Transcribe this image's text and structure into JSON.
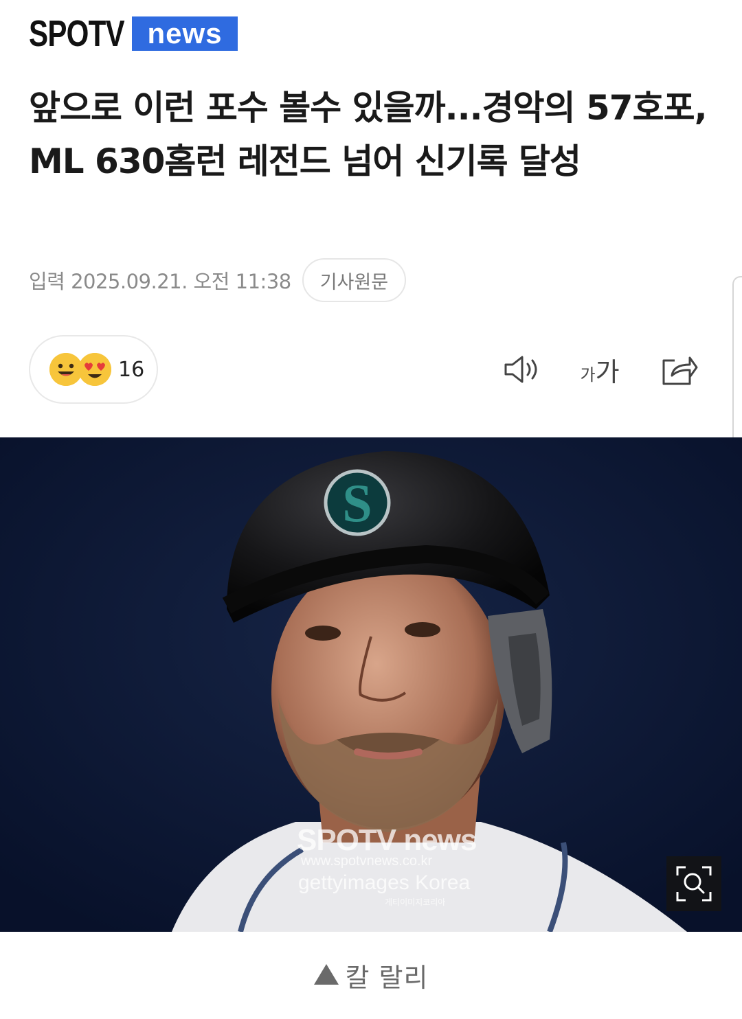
{
  "logo": {
    "part1": "SPOTV",
    "part2": "news"
  },
  "headline": "앞으로 이런 포수 볼수 있을까...경악의 57호포, ML 630홈런 레전드 넘어 신기록 달성",
  "meta": {
    "date": "입력 2025.09.21. 오전 11:38",
    "original_button": "기사원문"
  },
  "reaction": {
    "count": "16",
    "icons": [
      "smile-emoji",
      "heart-eyes-emoji"
    ]
  },
  "tools": {
    "font_small": "가",
    "font_large": "가",
    "icons": [
      "speaker-icon",
      "font-size-icon",
      "share-icon"
    ]
  },
  "photo": {
    "watermark_logo": "SPOTV news",
    "watermark_url": "www.spotvnews.co.kr",
    "watermark_getty": "gettyimages Korea",
    "watermark_getty_ko": "게티이미지코리아"
  },
  "caption": {
    "text": "칼 랄리"
  },
  "colors": {
    "brand_blue": "#2f6be0",
    "emoji_yellow": "#f7c53b",
    "photo_bg": "#0d1832"
  }
}
